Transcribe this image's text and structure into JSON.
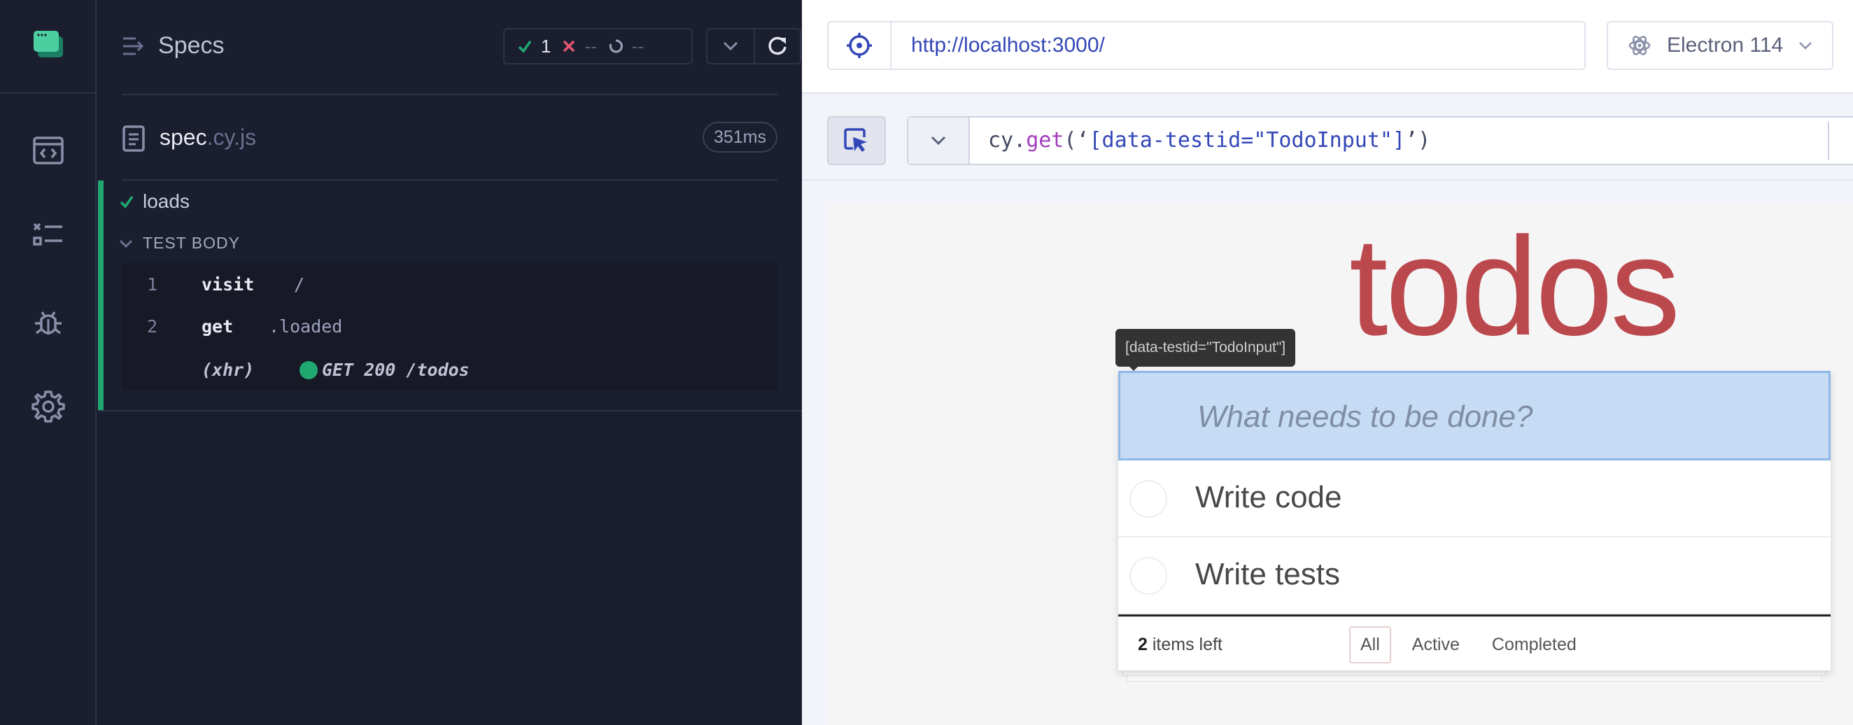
{
  "reporter": {
    "specs_title": "Specs",
    "stats": {
      "passed": "1",
      "failed": "--",
      "pending": "--"
    },
    "spec": {
      "name": "spec",
      "ext": ".cy.js",
      "duration": "351ms"
    },
    "test": {
      "title": "loads",
      "body_label": "TEST BODY",
      "commands": [
        {
          "num": "1",
          "name": "visit",
          "message": "/"
        },
        {
          "num": "2",
          "name": "get",
          "message": ".loaded"
        }
      ],
      "xhr": {
        "label": "(xhr)",
        "message": "GET 200 /todos"
      }
    }
  },
  "browser_bar": {
    "url": "http://localhost:3000/",
    "browser": "Electron 114"
  },
  "selector_playground": {
    "code_prefix": "cy.",
    "code_fn": "get",
    "code_open": "(‘",
    "code_selector": "[data-testid=\"TodoInput\"]",
    "code_close": "’)"
  },
  "app": {
    "heading": "todos",
    "tooltip": "[data-testid=\"TodoInput\"]",
    "input_placeholder": "What needs to be done?",
    "todos": [
      {
        "title": "Write code"
      },
      {
        "title": "Write tests"
      }
    ],
    "footer": {
      "count": "2",
      "count_suffix": " items left",
      "filters": [
        "All",
        "Active",
        "Completed"
      ],
      "selected_filter": "All"
    }
  },
  "colors": {
    "pass": "#1fa971",
    "fail": "#e45770",
    "todo_heading": "#b83f45",
    "url": "#3347b7"
  }
}
